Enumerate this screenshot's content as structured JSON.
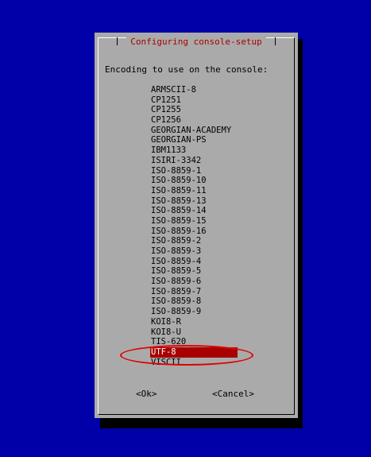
{
  "dialog": {
    "title": "Configuring console-setup",
    "prompt": "Encoding to use on the console:",
    "selected_index": 23,
    "options": [
      "ARMSCII-8",
      "CP1251",
      "CP1255",
      "CP1256",
      "GEORGIAN-ACADEMY",
      "GEORGIAN-PS",
      "IBM1133",
      "ISIRI-3342",
      "ISO-8859-1",
      "ISO-8859-10",
      "ISO-8859-11",
      "ISO-8859-13",
      "ISO-8859-14",
      "ISO-8859-15",
      "ISO-8859-16",
      "ISO-8859-2",
      "ISO-8859-3",
      "ISO-8859-4",
      "ISO-8859-5",
      "ISO-8859-6",
      "ISO-8859-7",
      "ISO-8859-8",
      "ISO-8859-9",
      "KOI8-R",
      "KOI8-U",
      "TIS-620",
      "UTF-8",
      "VISCII"
    ],
    "ok_label": "<Ok>",
    "cancel_label": "<Cancel>"
  },
  "colors": {
    "background": "#0000a8",
    "dialog": "#aaaaaa",
    "title_text": "#a80000",
    "selection": "#a80000",
    "annotation": "#e00000"
  }
}
